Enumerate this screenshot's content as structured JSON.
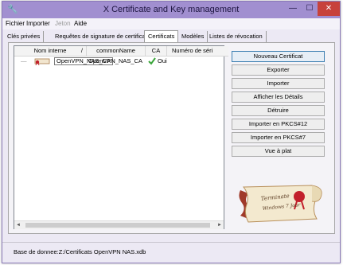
{
  "window": {
    "title": "X Certificate and Key management"
  },
  "menu": {
    "items": [
      "Fichier",
      "Importer",
      "Jeton",
      "Aide"
    ]
  },
  "tabs": [
    "Clés privées",
    "Requêtes de signature de certificat",
    "Certificats",
    "Modèles",
    "Listes de révocation"
  ],
  "active_tab": "Certificats",
  "table": {
    "columns": [
      "Nom interne",
      "/",
      "commonName",
      "CA",
      "Numéro de séri"
    ],
    "rows": [
      {
        "internal_name": "OpenVPN_NAS_CA",
        "common_name": "OpenVPN_NAS_CA",
        "ca": "Oui"
      }
    ]
  },
  "buttons": [
    "Nouveau Certificat",
    "Exporter",
    "Importer",
    "Afficher les Détails",
    "Détruire",
    "Importer en PKCS#12",
    "Importer en PKCS#7",
    "Vue à plat"
  ],
  "logo": {
    "text_line1": "Terminate",
    "text_line2": "Windows 7 Jour"
  },
  "status": {
    "text": "Base de donnee:Z:/Certificats OpenVPN NAS.xdb"
  },
  "colors": {
    "titlebar": "#a18fd0",
    "close_button": "#c7423c",
    "check": "#3aa53a",
    "ribbon": "#a03a2a",
    "seal": "#c2202b"
  },
  "icons": {
    "app": "wrench-icon",
    "certificate": "certificate-icon",
    "check": "check-icon",
    "logo": "parchment-scroll"
  }
}
